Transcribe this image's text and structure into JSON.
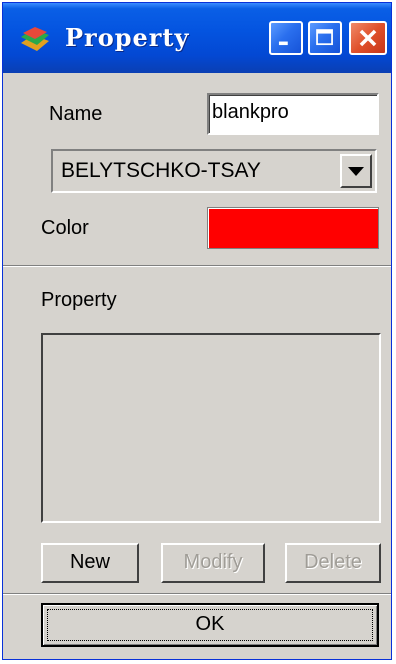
{
  "window": {
    "title": "Property",
    "app_icon": "app-logo-icon",
    "controls": [
      "minimize-icon",
      "maximize-icon",
      "close-icon"
    ]
  },
  "form": {
    "name_label": "Name",
    "name_value": "blankpro",
    "formulation_value": "BELYTSCHKO-TSAY",
    "color_label": "Color",
    "color_value": "#ff0000"
  },
  "property_section": {
    "label": "Property",
    "items": []
  },
  "buttons": {
    "new": "New",
    "modify": "Modify",
    "delete": "Delete",
    "ok": "OK"
  },
  "colors": {
    "titlebar": "#0454e0",
    "dialog_bg": "#d6d3ce",
    "close_button": "#e0512b"
  }
}
